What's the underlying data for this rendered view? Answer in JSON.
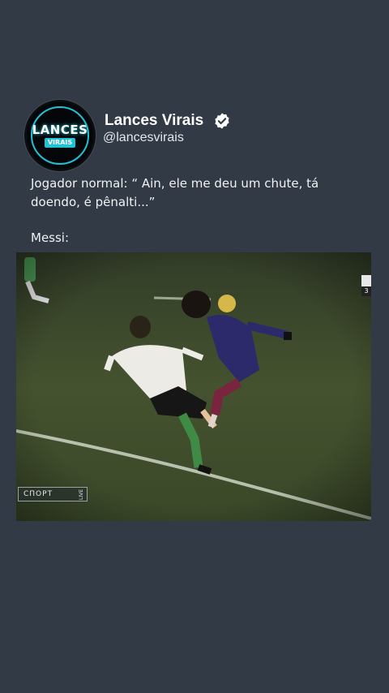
{
  "profile": {
    "avatar_main": "LANCES",
    "avatar_sub": "VIRAIS",
    "display_name": "Lances Virais",
    "handle": "@lancesvirais",
    "verified": true,
    "verified_icon": "verified-badge-icon"
  },
  "tweet": {
    "text_line1": "Jogador normal: “ Ain, ele me deu um chute, tá doendo, é pênalti...”",
    "text_line2": "Messi:"
  },
  "media": {
    "channel": "СПОРТ",
    "channel_live": "LIVE",
    "score_digit": "3"
  },
  "colors": {
    "background": "#323a45",
    "accent": "#1fc3d4",
    "pitch": "#3e4a30"
  }
}
